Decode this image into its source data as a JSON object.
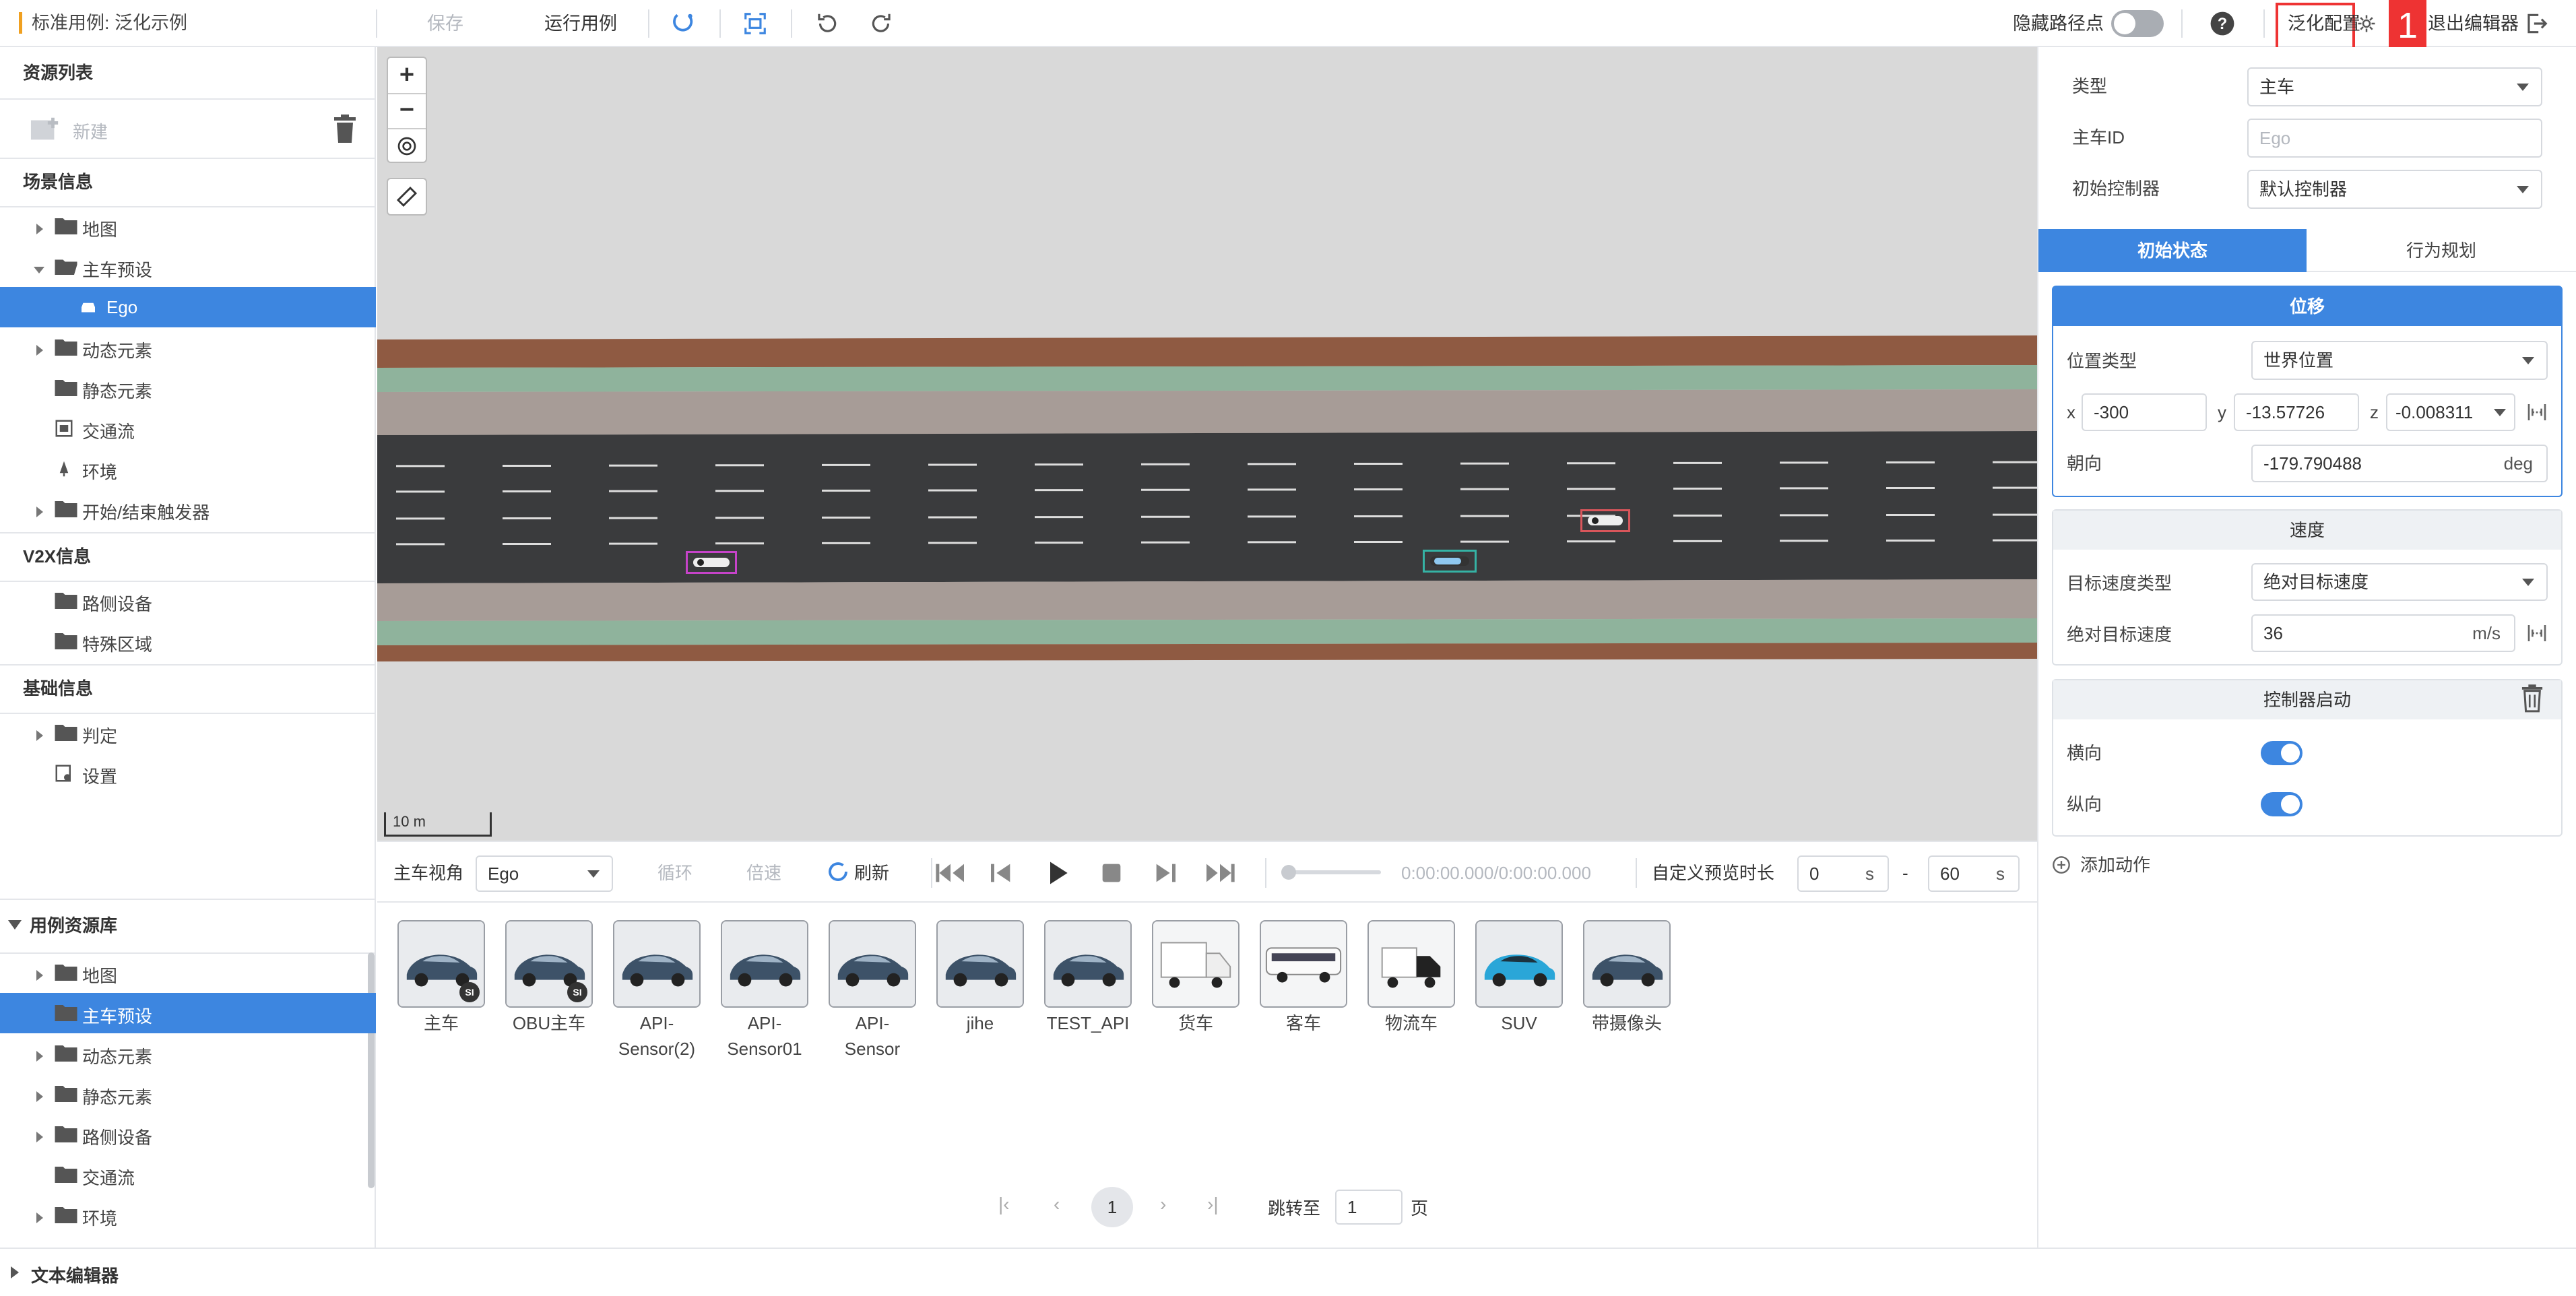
{
  "topbar": {
    "breadcrumb": "标准用例: 泛化示例",
    "save": "保存",
    "run": "运行用例",
    "hide_waypoints": "隐藏路径点",
    "generalize_config": "泛化配置",
    "exit_editor": "退出编辑器",
    "annotation_badge": "1"
  },
  "left": {
    "resources_title": "资源列表",
    "new_label": "新建",
    "scene_info": "场景信息",
    "scene_items": [
      "地图",
      "主车预设",
      "Ego",
      "动态元素",
      "静态元素",
      "交通流",
      "环境",
      "开始/结束触发器"
    ],
    "v2x_info": "V2X信息",
    "v2x_items": [
      "路侧设备",
      "特殊区域"
    ],
    "base_info": "基础信息",
    "base_items": [
      "判定",
      "设置"
    ],
    "library_title": "用例资源库",
    "library_items": [
      "地图",
      "主车预设",
      "动态元素",
      "静态元素",
      "路侧设备",
      "交通流",
      "环境"
    ]
  },
  "canvas": {
    "zoom_in": "+",
    "zoom_out": "−",
    "scale_label": "10 m"
  },
  "playbar": {
    "view_label": "主车视角",
    "view_value": "Ego",
    "loop": "循环",
    "speed": "倍速",
    "refresh": "刷新",
    "time": "0:00:00.000/0:00:00.000",
    "custom_duration": "自定义预览时长",
    "start_value": "0",
    "end_value": "60",
    "unit_s": "s",
    "dash": "-"
  },
  "assets": [
    {
      "name": "主车",
      "badge": "SI",
      "kind": "sedan"
    },
    {
      "name": "OBU主车",
      "badge": "SI",
      "kind": "sedan"
    },
    {
      "name": "API-\nSensor(2)",
      "badge": "",
      "kind": "sedan"
    },
    {
      "name": "API-\nSensor01",
      "badge": "",
      "kind": "sedan"
    },
    {
      "name": "API-\nSensor",
      "badge": "",
      "kind": "sedan"
    },
    {
      "name": "jihe",
      "badge": "",
      "kind": "sedan"
    },
    {
      "name": "TEST_API",
      "badge": "",
      "kind": "sedan"
    },
    {
      "name": "货车",
      "badge": "",
      "kind": "truck"
    },
    {
      "name": "客车",
      "badge": "",
      "kind": "bus"
    },
    {
      "name": "物流车",
      "badge": "",
      "kind": "van"
    },
    {
      "name": "SUV",
      "badge": "",
      "kind": "suv"
    },
    {
      "name": "带摄像头",
      "badge": "",
      "kind": "sedan"
    }
  ],
  "pagination": {
    "current": "1",
    "jump_label": "跳转至",
    "jump_value": "1",
    "page_suffix": "页"
  },
  "right": {
    "type_label": "类型",
    "type_value": "主车",
    "id_label": "主车ID",
    "id_placeholder": "Ego",
    "controller_label": "初始控制器",
    "controller_value": "默认控制器",
    "tab_initial": "初始状态",
    "tab_behavior": "行为规划",
    "position_title": "位移",
    "position_type_label": "位置类型",
    "position_type_value": "世界位置",
    "x_label": "x",
    "x_value": "-300",
    "y_label": "y",
    "y_value": "-13.57726",
    "z_label": "z",
    "z_value": "-0.008311",
    "heading_label": "朝向",
    "heading_value": "-179.790488",
    "heading_unit": "deg",
    "speed_title": "速度",
    "speed_type_label": "目标速度类型",
    "speed_type_value": "绝对目标速度",
    "abs_speed_label": "绝对目标速度",
    "abs_speed_value": "36",
    "abs_speed_unit": "m/s",
    "controller_start_title": "控制器启动",
    "lateral_label": "横向",
    "longitudinal_label": "纵向",
    "lateral_on": true,
    "longitudinal_on": true,
    "add_action": "添加动作"
  },
  "bottom": {
    "text_editor": "文本编辑器"
  },
  "colors": {
    "accent": "#3d86e0",
    "highlight_red": "#e33333",
    "road": "#3a3b3d",
    "curb_brown": "#8f5a42",
    "green_strip": "#8fb39c",
    "sidewalk": "#a79c97"
  }
}
